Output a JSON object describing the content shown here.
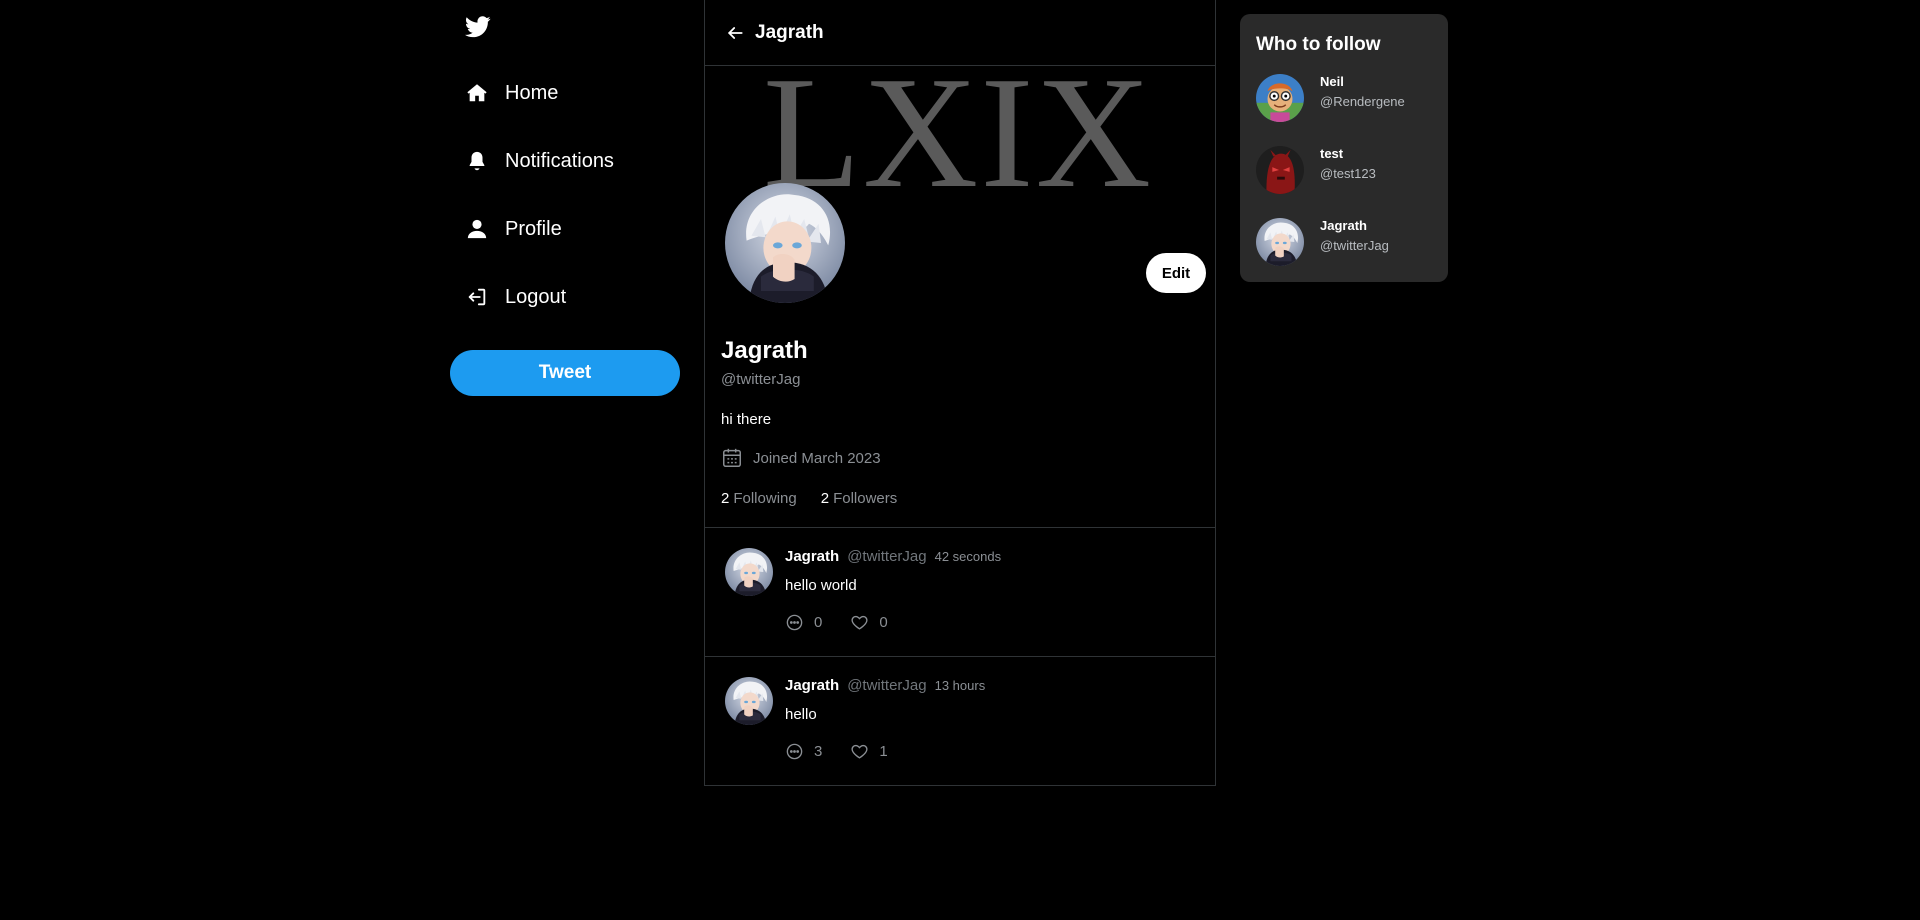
{
  "nav": {
    "logo_icon": "twitter-bird-icon",
    "items": [
      {
        "label": "Home",
        "icon": "home-icon"
      },
      {
        "label": "Notifications",
        "icon": "bell-icon"
      },
      {
        "label": "Profile",
        "icon": "user-icon"
      },
      {
        "label": "Logout",
        "icon": "logout-icon"
      }
    ],
    "tweet_button": "Tweet"
  },
  "header": {
    "title": "Jagrath",
    "back_icon": "arrow-left-icon"
  },
  "profile": {
    "banner_text": "LXIX",
    "name": "Jagrath",
    "handle": "@twitterJag",
    "bio": "hi there",
    "joined": "Joined March 2023",
    "edit_label": "Edit",
    "following_count": "2",
    "following_label": "Following",
    "followers_count": "2",
    "followers_label": "Followers"
  },
  "tweets": [
    {
      "name": "Jagrath",
      "handle": "@twitterJag",
      "time": "42 seconds",
      "text": "hello world",
      "replies": "0",
      "likes": "0"
    },
    {
      "name": "Jagrath",
      "handle": "@twitterJag",
      "time": "13 hours",
      "text": "hello",
      "replies": "3",
      "likes": "1"
    }
  ],
  "who_to_follow": {
    "title": "Who to follow",
    "users": [
      {
        "name": "Neil",
        "handle": "@Rendergene"
      },
      {
        "name": "test",
        "handle": "@test123"
      },
      {
        "name": "Jagrath",
        "handle": "@twitterJag"
      }
    ]
  },
  "colors": {
    "accent": "#1d9bf0",
    "background": "#000000",
    "panel": "#2a2a2a",
    "muted_text": "#8b8f94",
    "border": "#2f3336"
  }
}
